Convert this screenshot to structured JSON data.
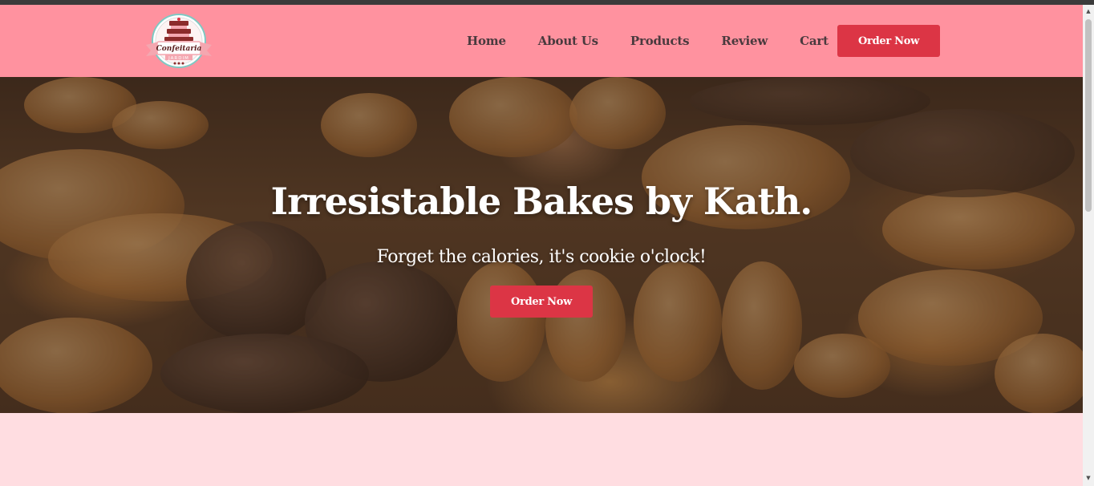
{
  "brand": {
    "logo_line1": "Confeitaria",
    "logo_line2": "JARDIM"
  },
  "nav": {
    "items": [
      {
        "label": "Home"
      },
      {
        "label": "About Us"
      },
      {
        "label": "Products"
      },
      {
        "label": "Review"
      },
      {
        "label": "Cart"
      }
    ],
    "cta_label": "Order Now"
  },
  "hero": {
    "title": "Irresistable Bakes by Kath.",
    "subtitle": "Forget the calories, it's cookie o'clock!",
    "cta_label": "Order Now"
  },
  "colors": {
    "navbar_bg": "#ff929f",
    "accent": "#dc3545",
    "page_bg": "#ffdde1"
  }
}
